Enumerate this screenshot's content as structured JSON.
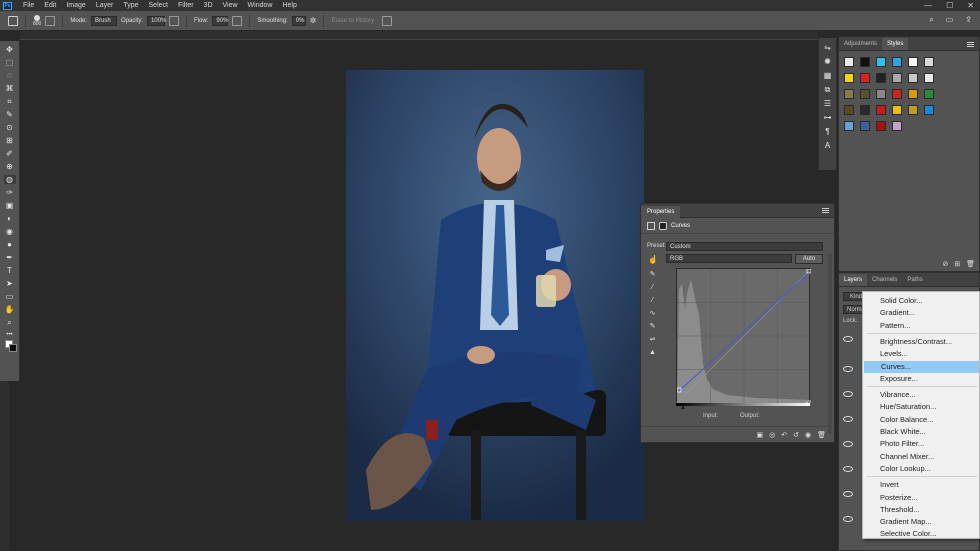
{
  "app": {
    "logo": "Ps"
  },
  "menubar": [
    "File",
    "Edit",
    "Image",
    "Layer",
    "Type",
    "Select",
    "Filter",
    "3D",
    "View",
    "Window",
    "Help"
  ],
  "window_controls": {
    "minimize": "—",
    "maximize": "☐",
    "close": "✕"
  },
  "options_bar": {
    "brush_size": "800",
    "mode_label": "Mode:",
    "mode_value": "Brush",
    "opacity_label": "Opacity:",
    "opacity_value": "100%",
    "flow_label": "Flow:",
    "flow_value": "90%",
    "smoothing_label": "Smoothing:",
    "smoothing_value": "0%",
    "erase_to_history": "Erase to History",
    "search_icon": "⌕"
  },
  "toolbar": {
    "tools": [
      "✥",
      "⬚",
      "◌",
      "⌘",
      "⌗",
      "✎",
      "⊙",
      "⊞",
      "✐",
      "⊕",
      "◍",
      "✑",
      "▣",
      "◐",
      "◉",
      "●",
      "✒",
      "T",
      "➤",
      "▭",
      "✋",
      "⌕",
      "•••"
    ]
  },
  "panels": {
    "adjustments_tab": "Adjustments",
    "styles_tab": "Styles",
    "layers_tab": "Layers",
    "channels_tab": "Channels",
    "paths_tab": "Paths",
    "layers_search": "Kind",
    "layers_mode": "Normal",
    "layers_lock": "Lock:",
    "style_swatches": [
      "#e8e8e8",
      "#111111",
      "#29c4f0",
      "#2aa7e0",
      "#f6f6f6",
      "#d8d8d8",
      "#f0d800",
      "#e02020",
      "#222222",
      "#aaaaaa",
      "#c8c8c8",
      "#e8e8e8",
      "#8a7a4a",
      "#5a5030",
      "#888888",
      "#cc2222",
      "#d69e00",
      "#2a8a3a",
      "#5a4a20",
      "#2a2a2a",
      "#cc1818",
      "#f0c000",
      "#c0a020",
      "#1a8ad8",
      "#6aa0d8",
      "#3a60a0",
      "#aa1010",
      "#c8a0c8"
    ]
  },
  "properties": {
    "tab": "Properties",
    "title": "Curves",
    "preset_label": "Preset:",
    "preset_value": "Custom",
    "channel_value": "RGB",
    "auto_label": "Auto",
    "input_label": "Input:",
    "output_label": "Output:",
    "curve_tools": [
      "✎",
      "⁄",
      "⁄",
      "⁄",
      "∿",
      "✎",
      "⇌",
      "▲"
    ],
    "footer_icons": [
      "▣",
      "◎",
      "↶",
      "↺",
      "◉",
      "🗑"
    ]
  },
  "context_menu": {
    "groups": [
      [
        "Solid Color...",
        "Gradient...",
        "Pattern..."
      ],
      [
        "Brightness/Contrast...",
        "Levels...",
        "Curves...",
        "Exposure..."
      ],
      [
        "Vibrance...",
        "Hue/Saturation...",
        "Color Balance...",
        "Black  White...",
        "Photo Filter...",
        "Channel Mixer...",
        "Color Lookup..."
      ],
      [
        "Invert",
        "Posterize...",
        "Threshold...",
        "Gradient Map...",
        "Selective Color..."
      ]
    ],
    "highlighted": "Curves..."
  },
  "colors": {
    "ui_dark": "#282828",
    "panel": "#535353",
    "highlight": "#91c9f7",
    "curve_line": "#4a54d8"
  }
}
